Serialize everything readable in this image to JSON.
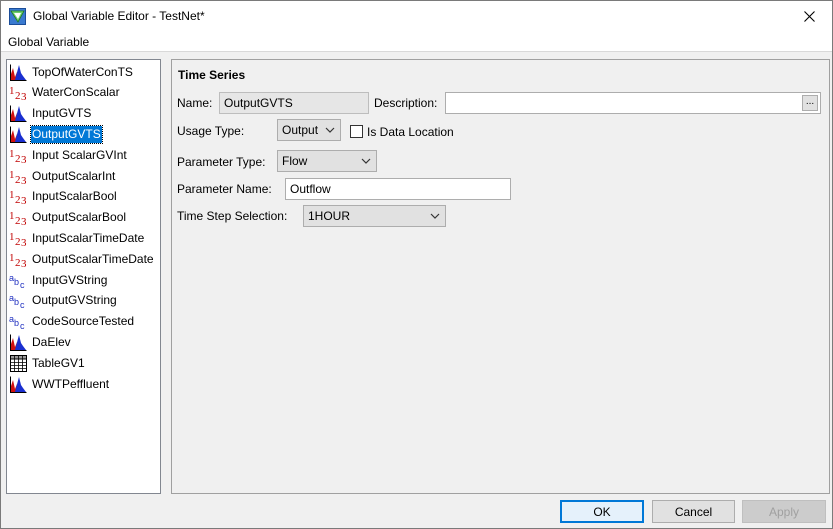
{
  "window": {
    "title": "Global Variable Editor - TestNet*"
  },
  "menu": {
    "global_variable": "Global Variable"
  },
  "tree": {
    "items": [
      {
        "label": "TopOfWaterConTS",
        "icon": "time-series-icon"
      },
      {
        "label": "WaterConScalar",
        "icon": "scalar-numeric-icon"
      },
      {
        "label": "InputGVTS",
        "icon": "time-series-icon"
      },
      {
        "label": "OutputGVTS",
        "icon": "time-series-icon",
        "selected": true
      },
      {
        "label": "Input ScalarGVInt",
        "icon": "scalar-numeric-icon"
      },
      {
        "label": "OutputScalarInt",
        "icon": "scalar-numeric-icon"
      },
      {
        "label": "InputScalarBool",
        "icon": "scalar-numeric-icon"
      },
      {
        "label": "OutputScalarBool",
        "icon": "scalar-numeric-icon"
      },
      {
        "label": "InputScalarTimeDate",
        "icon": "scalar-numeric-icon"
      },
      {
        "label": "OutputScalarTimeDate",
        "icon": "scalar-numeric-icon"
      },
      {
        "label": "InputGVString",
        "icon": "string-icon"
      },
      {
        "label": "OutputGVString",
        "icon": "string-icon"
      },
      {
        "label": "CodeSourceTested",
        "icon": "string-icon"
      },
      {
        "label": "DaElev",
        "icon": "time-series-icon"
      },
      {
        "label": "TableGV1",
        "icon": "table-icon"
      },
      {
        "label": "WWTPeffluent",
        "icon": "time-series-icon"
      }
    ]
  },
  "panel": {
    "section_title": "Time Series",
    "name_label": "Name:",
    "name_value": "OutputGVTS",
    "description_label": "Description:",
    "description_value": "",
    "description_button": "...",
    "usage_type_label": "Usage Type:",
    "usage_type_value": "Output",
    "is_data_location_label": "Is Data Location",
    "is_data_location_checked": false,
    "parameter_type_label": "Parameter Type:",
    "parameter_type_value": "Flow",
    "parameter_name_label": "Parameter Name:",
    "parameter_name_value": "Outflow",
    "time_step_label": "Time Step Selection:",
    "time_step_value": "1HOUR"
  },
  "buttons": {
    "ok": "OK",
    "cancel": "Cancel",
    "apply": "Apply"
  },
  "colors": {
    "selection": "#0078d7",
    "ts_red": "#d01010",
    "ts_blue": "#1a2fd0",
    "numeric_red": "#c00000",
    "string_blue": "#2030c0"
  }
}
